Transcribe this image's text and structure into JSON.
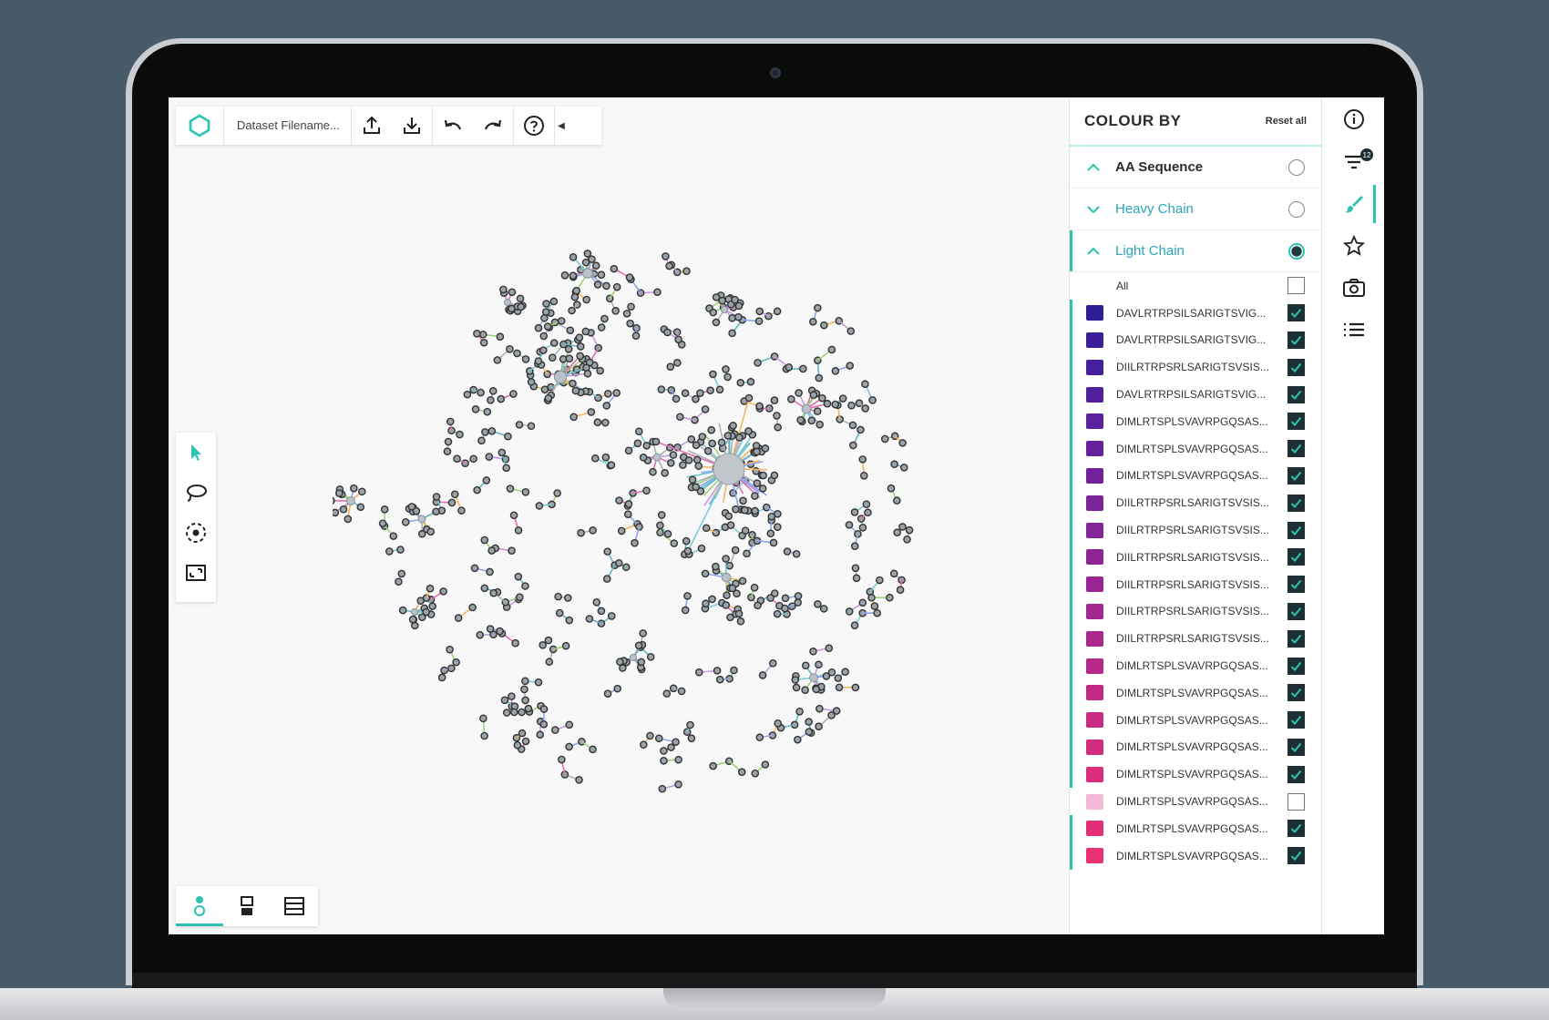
{
  "toolbar": {
    "filename": "Dataset Filename...",
    "logo_icon": "hexagon-logo-icon",
    "buttons": [
      "upload-icon",
      "download-icon",
      "undo-icon",
      "redo-icon",
      "help-icon"
    ]
  },
  "colours": {
    "accent": "#2cc4b0",
    "dark": "#1d2e35"
  },
  "panel": {
    "title": "COLOUR BY",
    "reset_label": "Reset all",
    "sections": [
      {
        "label": "AA Sequence",
        "color": "#2b2b2b",
        "bold": true,
        "expanded": true,
        "selected": false
      },
      {
        "label": "Heavy Chain",
        "color": "#2aa6b8",
        "bold": false,
        "expanded": false,
        "selected": false
      },
      {
        "label": "Light Chain",
        "color": "#2aa6b8",
        "bold": false,
        "expanded": true,
        "selected": true
      }
    ],
    "all_label": "All",
    "rows": [
      {
        "seq": "DAVLRTRPSILSARIGTSVIG...",
        "color": "#2e1f96",
        "checked": true
      },
      {
        "seq": "DAVLRTRPSILSARIGTSVIG...",
        "color": "#3b1f9a",
        "checked": true
      },
      {
        "seq": "DIILRTRPSRLSARIGTSVSIS...",
        "color": "#46209c",
        "checked": true
      },
      {
        "seq": "DAVLRTRPSILSARIGTSVIG...",
        "color": "#52209d",
        "checked": true
      },
      {
        "seq": "DIMLRTSPLSVAVRPGQSAS...",
        "color": "#5c219e",
        "checked": true
      },
      {
        "seq": "DIMLRTSPLSVAVRPGQSAS...",
        "color": "#66219c",
        "checked": true
      },
      {
        "seq": "DIMLRTSPLSVAVRPGQSAS...",
        "color": "#71229b",
        "checked": true
      },
      {
        "seq": "DIILRTRPSRLSARIGTSVSIS...",
        "color": "#7b2399",
        "checked": true
      },
      {
        "seq": "DIILRTRPSRLSARIGTSVSIS...",
        "color": "#852497",
        "checked": true
      },
      {
        "seq": "DIILRTRPSRLSARIGTSVSIS...",
        "color": "#8f2594",
        "checked": true
      },
      {
        "seq": "DIILRTRPSRLSARIGTSVSIS...",
        "color": "#992692",
        "checked": true
      },
      {
        "seq": "DIILRTRPSRLSARIGTSVSIS...",
        "color": "#a3278f",
        "checked": true
      },
      {
        "seq": "DIILRTRPSRLSARIGTSVSIS...",
        "color": "#ad288c",
        "checked": true
      },
      {
        "seq": "DIMLRTSPLSVAVRPGQSAS...",
        "color": "#b72988",
        "checked": true
      },
      {
        "seq": "DIMLRTSPLSVAVRPGQSAS...",
        "color": "#c02a85",
        "checked": true
      },
      {
        "seq": "DIMLRTSPLSVAVRPGQSAS...",
        "color": "#c92b82",
        "checked": true
      },
      {
        "seq": "DIMLRTSPLSVAVRPGQSAS...",
        "color": "#d22c7f",
        "checked": true
      },
      {
        "seq": "DIMLRTSPLSVAVRPGQSAS...",
        "color": "#db2d7c",
        "checked": true
      },
      {
        "seq": "DIMLRTSPLSVAVRPGQSAS...",
        "color": "#f5b8d6",
        "checked": false
      },
      {
        "seq": "DIMLRTSPLSVAVRPGQSAS...",
        "color": "#e42f78",
        "checked": true
      },
      {
        "seq": "DIMLRTSPLSVAVRPGQSAS...",
        "color": "#ea3075",
        "checked": true
      }
    ]
  },
  "rail": {
    "filter_count": "12"
  }
}
